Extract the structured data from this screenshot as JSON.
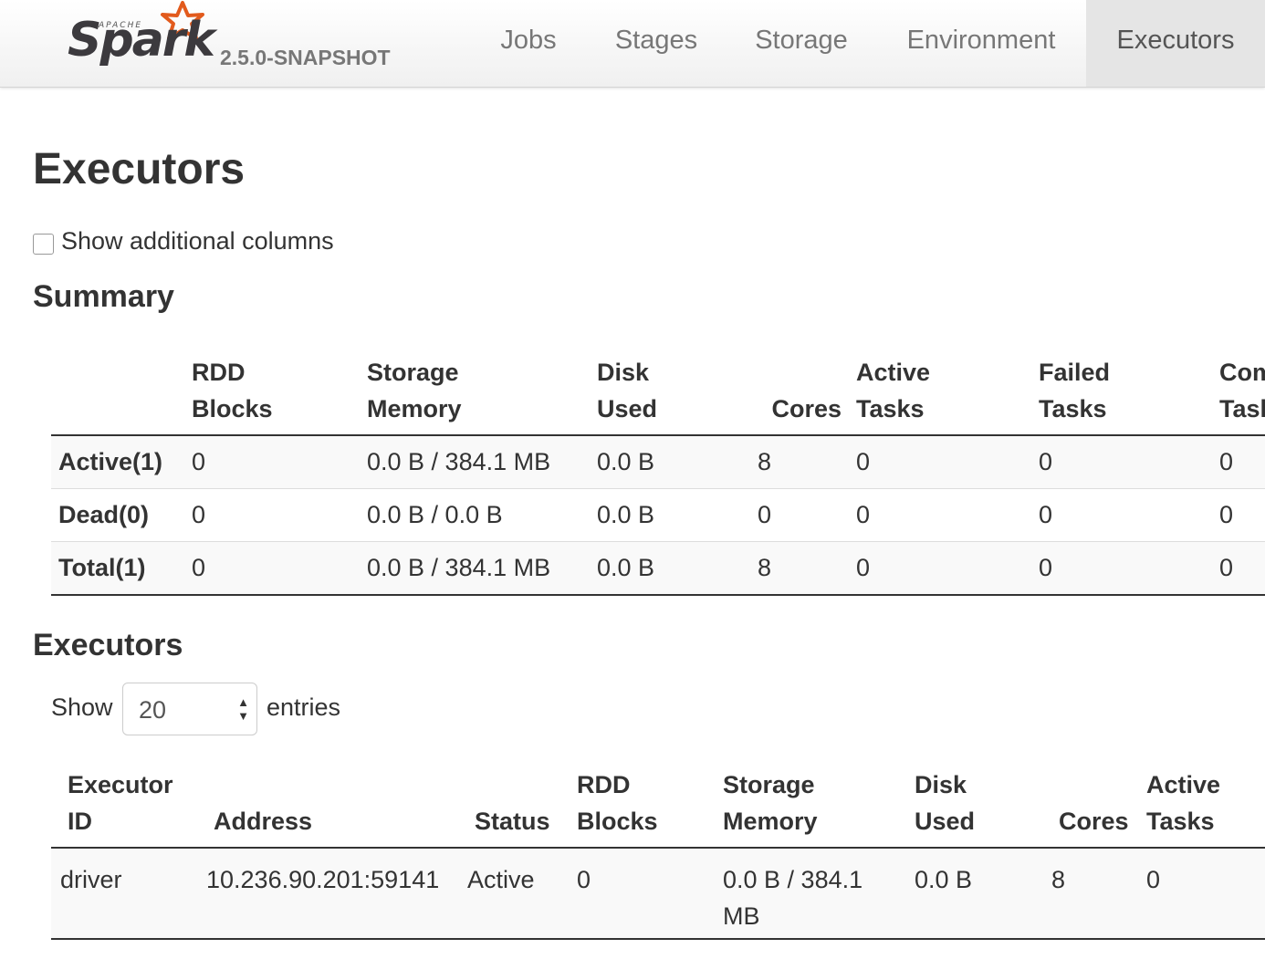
{
  "navbar": {
    "logo_apache": "APACHE",
    "logo_spark": "Spark",
    "version": "2.5.0-SNAPSHOT",
    "tabs": [
      {
        "label": "Jobs"
      },
      {
        "label": "Stages"
      },
      {
        "label": "Storage"
      },
      {
        "label": "Environment"
      },
      {
        "label": "Executors",
        "active": true
      }
    ],
    "star_color": "#e25a1c"
  },
  "page": {
    "title": "Executors",
    "additional_columns_label": "Show additional columns",
    "additional_columns_checked": false
  },
  "summary": {
    "title": "Summary",
    "headers": [
      "",
      "RDD Blocks",
      "Storage Memory",
      "Disk Used",
      "Cores",
      "Active Tasks",
      "Failed Tasks",
      "Complete Tasks"
    ],
    "header_lines": [
      [
        "",
        ""
      ],
      [
        "RDD",
        "Blocks"
      ],
      [
        "Storage",
        "Memory"
      ],
      [
        "Disk",
        "Used"
      ],
      [
        "",
        "Cores"
      ],
      [
        "Active",
        "Tasks"
      ],
      [
        "Failed",
        "Tasks"
      ],
      [
        "Complete",
        "Tasks"
      ]
    ],
    "rows": [
      [
        "Active(1)",
        "0",
        "0.0 B / 384.1 MB",
        "0.0 B",
        "8",
        "0",
        "0",
        "0"
      ],
      [
        "Dead(0)",
        "0",
        "0.0 B / 0.0 B",
        "0.0 B",
        "0",
        "0",
        "0",
        "0"
      ],
      [
        "Total(1)",
        "0",
        "0.0 B / 384.1 MB",
        "0.0 B",
        "8",
        "0",
        "0",
        "0"
      ]
    ]
  },
  "executors": {
    "title": "Executors",
    "show_label": "Show",
    "page_size": "20",
    "entries_label": "entries",
    "header_lines": [
      [
        "Executor",
        "ID"
      ],
      [
        "",
        "Address"
      ],
      [
        "",
        "Status"
      ],
      [
        "RDD",
        "Blocks"
      ],
      [
        "Storage",
        "Memory"
      ],
      [
        "Disk",
        "Used"
      ],
      [
        "",
        "Cores"
      ],
      [
        "Active",
        "Tasks"
      ]
    ],
    "rows": [
      [
        "driver",
        "10.236.90.201:59141",
        "Active",
        "0",
        "0.0 B / 384.1 MB",
        "0.0 B",
        "8",
        "0"
      ]
    ]
  }
}
